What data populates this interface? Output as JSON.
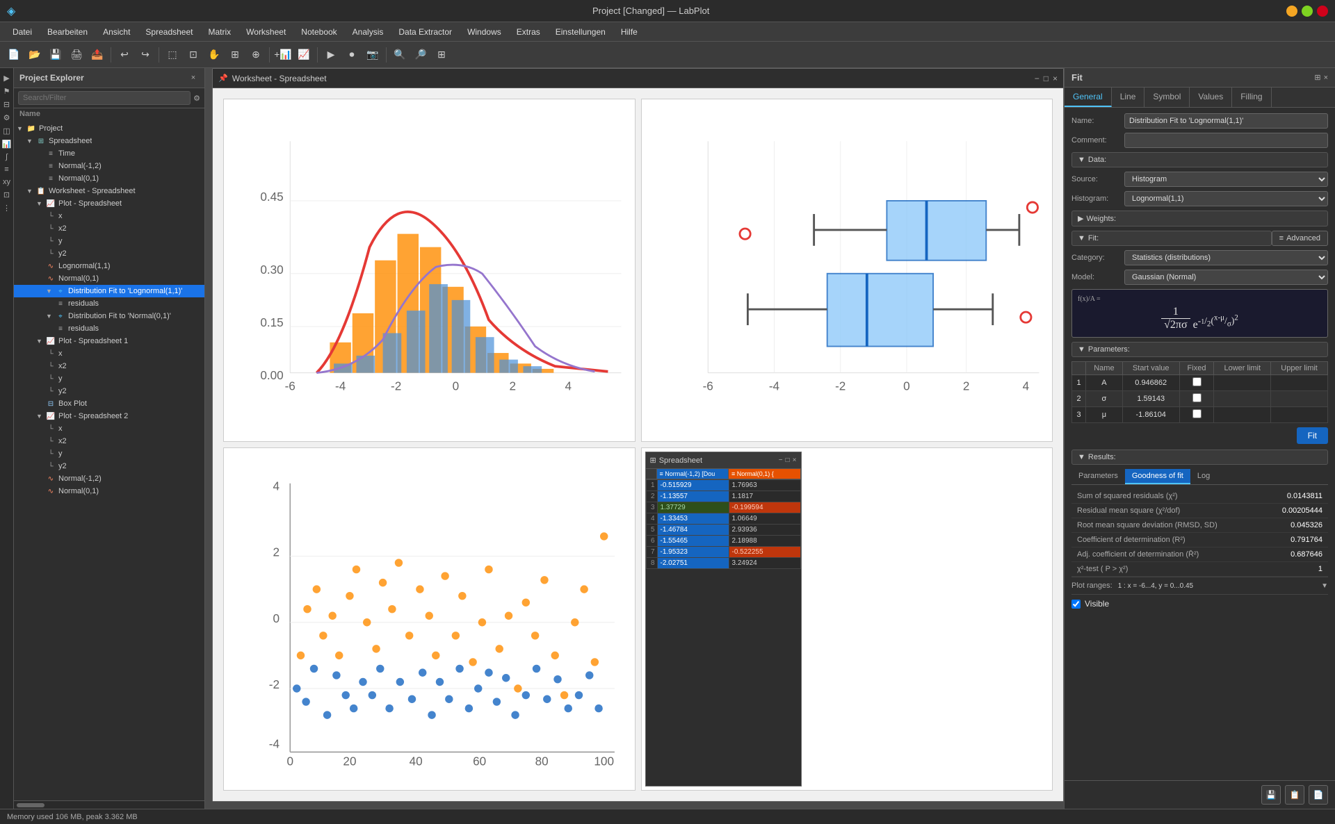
{
  "titlebar": {
    "title": "Project [Changed] — LabPlot",
    "minimize": "−",
    "maximize": "□",
    "close": "×"
  },
  "menubar": {
    "items": [
      "Datei",
      "Bearbeiten",
      "Ansicht",
      "Spreadsheet",
      "Matrix",
      "Worksheet",
      "Notebook",
      "Analysis",
      "Data Extractor",
      "Windows",
      "Extras",
      "Einstellungen",
      "Hilfe"
    ]
  },
  "sidebar": {
    "title": "Project Explorer",
    "search_placeholder": "Search/Filter",
    "name_header": "Name",
    "tree": [
      {
        "id": "project",
        "label": "Project",
        "level": 0,
        "icon": "folder",
        "type": "folder"
      },
      {
        "id": "spreadsheet",
        "label": "Spreadsheet",
        "level": 1,
        "icon": "spreadsheet",
        "type": "spreadsheet"
      },
      {
        "id": "time",
        "label": "Time",
        "level": 2,
        "icon": "column",
        "type": "column"
      },
      {
        "id": "normal12",
        "label": "Normal(-1,2)",
        "level": 2,
        "icon": "column",
        "type": "column"
      },
      {
        "id": "normal01",
        "label": "Normal(0,1)",
        "level": 2,
        "icon": "column",
        "type": "column"
      },
      {
        "id": "worksheet-spreadsheet",
        "label": "Worksheet - Spreadsheet",
        "level": 1,
        "icon": "worksheet",
        "type": "worksheet"
      },
      {
        "id": "plot-spreadsheet",
        "label": "Plot - Spreadsheet",
        "level": 2,
        "icon": "plot",
        "type": "plot"
      },
      {
        "id": "x",
        "label": "x",
        "level": 3,
        "icon": "axis",
        "type": "axis"
      },
      {
        "id": "x2",
        "label": "x2",
        "level": 3,
        "icon": "axis",
        "type": "axis"
      },
      {
        "id": "y",
        "label": "y",
        "level": 3,
        "icon": "axis",
        "type": "axis"
      },
      {
        "id": "y2",
        "label": "y2",
        "level": 3,
        "icon": "axis",
        "type": "axis"
      },
      {
        "id": "lognormal11",
        "label": "Lognormal(1,1)",
        "level": 3,
        "icon": "curve",
        "type": "curve"
      },
      {
        "id": "normal01b",
        "label": "Normal(0,1)",
        "level": 3,
        "icon": "curve",
        "type": "curve"
      },
      {
        "id": "dist-fit-lognormal",
        "label": "Distribution Fit to 'Lognormal(1,1)'",
        "level": 3,
        "icon": "fit",
        "type": "fit",
        "selected": true
      },
      {
        "id": "residuals1",
        "label": "residuals",
        "level": 4,
        "icon": "residuals",
        "type": "residuals"
      },
      {
        "id": "dist-fit-normal",
        "label": "Distribution Fit to 'Normal(0,1)'",
        "level": 3,
        "icon": "fit",
        "type": "fit"
      },
      {
        "id": "residuals2",
        "label": "residuals",
        "level": 4,
        "icon": "residuals",
        "type": "residuals"
      },
      {
        "id": "plot-spreadsheet1",
        "label": "Plot - Spreadsheet 1",
        "level": 2,
        "icon": "plot",
        "type": "plot"
      },
      {
        "id": "x3",
        "label": "x",
        "level": 3,
        "icon": "axis",
        "type": "axis"
      },
      {
        "id": "x4",
        "label": "x2",
        "level": 3,
        "icon": "axis",
        "type": "axis"
      },
      {
        "id": "y3",
        "label": "y",
        "level": 3,
        "icon": "axis",
        "type": "axis"
      },
      {
        "id": "y4",
        "label": "y2",
        "level": 3,
        "icon": "axis",
        "type": "axis"
      },
      {
        "id": "boxplot",
        "label": "Box Plot",
        "level": 3,
        "icon": "boxplot",
        "type": "boxplot"
      },
      {
        "id": "plot-spreadsheet2",
        "label": "Plot - Spreadsheet 2",
        "level": 2,
        "icon": "plot",
        "type": "plot"
      },
      {
        "id": "x5",
        "label": "x",
        "level": 3,
        "icon": "axis",
        "type": "axis"
      },
      {
        "id": "x6",
        "label": "x2",
        "level": 3,
        "icon": "axis",
        "type": "axis"
      },
      {
        "id": "y5",
        "label": "y",
        "level": 3,
        "icon": "axis",
        "type": "axis"
      },
      {
        "id": "y6",
        "label": "y2",
        "level": 3,
        "icon": "axis",
        "type": "axis"
      },
      {
        "id": "normal12b",
        "label": "Normal(-1,2)",
        "level": 3,
        "icon": "curve",
        "type": "curve"
      },
      {
        "id": "normal01c",
        "label": "Normal(0,1)",
        "level": 3,
        "icon": "curve",
        "type": "curve"
      }
    ]
  },
  "worksheet": {
    "title": "Worksheet - Spreadsheet"
  },
  "spreadsheet_window": {
    "title": "Spreadsheet",
    "col1_header": "Normal(-1,2) [Dou",
    "col2_header": "Normal(0,1) {",
    "rows": [
      {
        "num": 1,
        "col1": "-0.515929",
        "col2": "1.76963",
        "col1_type": "blue",
        "col2_type": "normal"
      },
      {
        "num": 2,
        "col1": "-1.13557",
        "col2": "1.1817",
        "col1_type": "blue",
        "col2_type": "normal"
      },
      {
        "num": 3,
        "col1": "1.37729",
        "col2": "-0.199594",
        "col1_type": "normal",
        "col2_type": "orange"
      },
      {
        "num": 4,
        "col1": "-1.33453",
        "col2": "1.06649",
        "col1_type": "blue",
        "col2_type": "normal"
      },
      {
        "num": 5,
        "col1": "-1.46784",
        "col2": "2.93936",
        "col1_type": "blue",
        "col2_type": "normal"
      },
      {
        "num": 6,
        "col1": "-1.55465",
        "col2": "2.18988",
        "col1_type": "blue",
        "col2_type": "normal"
      },
      {
        "num": 7,
        "col1": "-1.95323",
        "col2": "-0.522255",
        "col1_type": "blue",
        "col2_type": "orange"
      },
      {
        "num": 8,
        "col1": "-2.02751",
        "col2": "3.24924",
        "col1_type": "blue",
        "col2_type": "normal"
      }
    ]
  },
  "right_panel": {
    "title": "Fit",
    "tabs": [
      "General",
      "Line",
      "Symbol",
      "Values",
      "Filling"
    ],
    "active_tab": "General",
    "name_label": "Name:",
    "name_value": "Distribution Fit to 'Lognormal(1,1)'",
    "comment_label": "Comment:",
    "comment_value": "",
    "data_section": "Data:",
    "source_label": "Source:",
    "source_value": "Histogram",
    "histogram_label": "Histogram:",
    "histogram_value": "Lognormal(1,1)",
    "weights_section": "Weights:",
    "fit_section": "Fit:",
    "advanced_btn": "Advanced",
    "category_label": "Category:",
    "category_value": "Statistics (distributions)",
    "model_label": "Model:",
    "model_value": "Gaussian (Normal)",
    "formula_label": "f(x)/A =",
    "formula": "1/(√(2πσ)) · e^(-½((x-μ)/σ)²)",
    "parameters_section": "Parameters:",
    "params_headers": [
      "Name",
      "Start value",
      "Fixed",
      "Lower limit",
      "Upper limit"
    ],
    "params": [
      {
        "num": 1,
        "name": "A",
        "value": "0.946862",
        "fixed": false,
        "lower": "",
        "upper": ""
      },
      {
        "num": 2,
        "name": "σ",
        "value": "1.59143",
        "fixed": false,
        "lower": "",
        "upper": ""
      },
      {
        "num": 3,
        "name": "μ",
        "value": "-1.86104",
        "fixed": false,
        "lower": "",
        "upper": ""
      }
    ],
    "fit_button": "Fit",
    "results_section": "Results:",
    "results_tabs": [
      "Parameters",
      "Goodness of fit",
      "Log"
    ],
    "active_results_tab": "Goodness of fit",
    "results": [
      {
        "label": "Sum of squared residuals (χ²)",
        "value": "0.0143811"
      },
      {
        "label": "Residual mean square (χ²/dof)",
        "value": "0.00205444"
      },
      {
        "label": "Root mean square deviation (RMSD, SD)",
        "value": "0.045326"
      },
      {
        "label": "Coefficient of determination (R²)",
        "value": "0.791764"
      },
      {
        "label": "Adj. coefficient of determination (R̄²)",
        "value": "0.687646"
      },
      {
        "label": "χ²-test ( P > χ²)",
        "value": "1"
      }
    ],
    "plot_ranges_label": "Plot ranges:",
    "plot_ranges_value": "1 : x = -6...4, y = 0...0.45",
    "visible_label": "Visible",
    "visible_checked": true
  },
  "statusbar": {
    "text": "Memory used 106 MB, peak 3.362 MB"
  }
}
